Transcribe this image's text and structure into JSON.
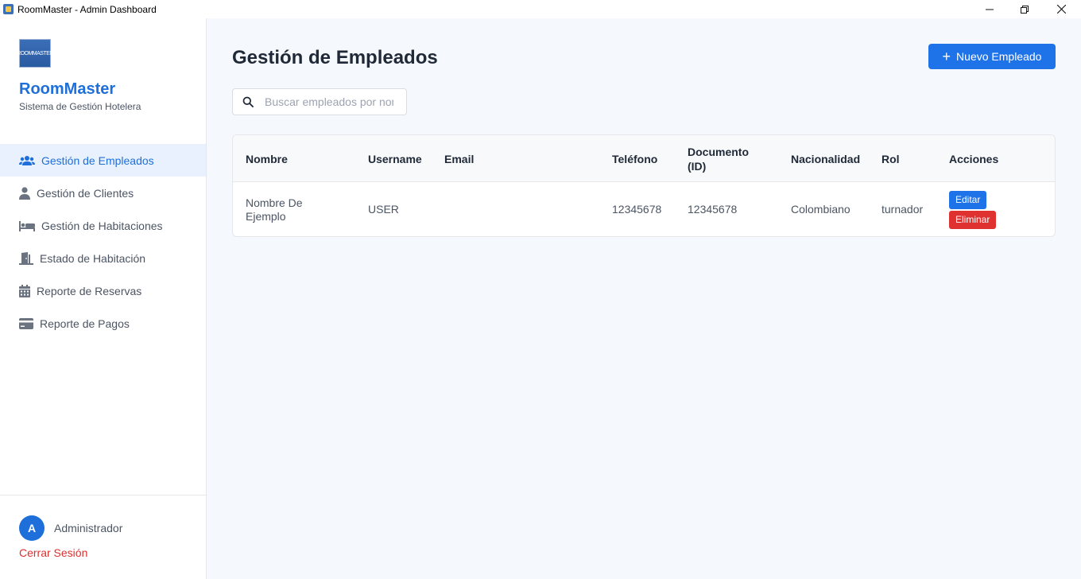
{
  "window": {
    "title": "RoomMaster - Admin Dashboard"
  },
  "sidebar": {
    "logo_text": "ROOMMASTER",
    "brand": "RoomMaster",
    "subtitle": "Sistema de Gestión Hotelera",
    "items": [
      {
        "label": "Gestión de Empleados",
        "icon": "users-icon",
        "active": true
      },
      {
        "label": "Gestión de Clientes",
        "icon": "user-icon",
        "active": false
      },
      {
        "label": "Gestión de Habitaciones",
        "icon": "bed-icon",
        "active": false
      },
      {
        "label": "Estado de Habitación",
        "icon": "door-icon",
        "active": false
      },
      {
        "label": "Reporte de Reservas",
        "icon": "calendar-icon",
        "active": false
      },
      {
        "label": "Reporte de Pagos",
        "icon": "credit-card-icon",
        "active": false
      }
    ],
    "user": {
      "avatar_letter": "A",
      "name": "Administrador",
      "logout_label": "Cerrar Sesión"
    }
  },
  "main": {
    "title": "Gestión de Empleados",
    "new_button_label": "Nuevo Empleado",
    "search": {
      "placeholder": "Buscar empleados por nombre",
      "value": ""
    },
    "table": {
      "headers": {
        "nombre": "Nombre",
        "username": "Username",
        "email": "Email",
        "telefono": "Teléfono",
        "documento": "Documento (ID)",
        "nacionalidad": "Nacionalidad",
        "rol": "Rol",
        "acciones": "Acciones"
      },
      "rows": [
        {
          "nombre": "Nombre De Ejemplo",
          "username": "USER",
          "email": "",
          "telefono": "12345678",
          "documento": "12345678",
          "nacionalidad": "Colombiano",
          "rol": "turnador",
          "edit_label": "Editar",
          "delete_label": "Eliminar"
        }
      ]
    }
  },
  "colors": {
    "accent": "#1e73e8",
    "brand": "#1e6fd9",
    "danger": "#e03131",
    "active_bg": "#e8f1fd"
  }
}
